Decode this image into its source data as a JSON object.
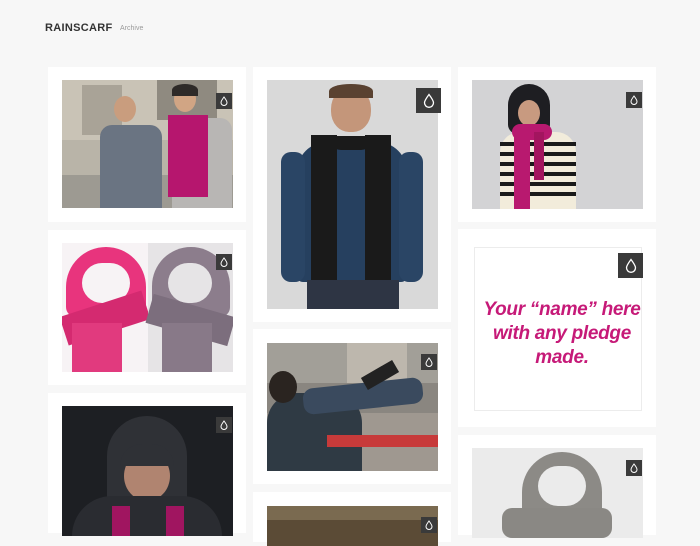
{
  "header": {
    "brand": "RAINSCARF",
    "nav_archive": "Archive"
  },
  "pledge_card": {
    "text": "Your “name” here with any pledge made."
  },
  "colors": {
    "accent_magenta": "#c61a78",
    "badge_bg": "#3a3a3a",
    "page_bg": "#f7f7f7"
  },
  "icons": {
    "badge_icon": "raindrop-icon"
  },
  "posts": [
    {
      "kind": "photo",
      "icon": "raindrop-icon"
    },
    {
      "kind": "photo",
      "icon": "raindrop-icon"
    },
    {
      "kind": "photo",
      "icon": "raindrop-icon"
    },
    {
      "kind": "photo",
      "icon": "raindrop-icon"
    },
    {
      "kind": "text",
      "icon": "raindrop-icon"
    },
    {
      "kind": "photo",
      "icon": "raindrop-icon"
    },
    {
      "kind": "photo",
      "icon": "raindrop-icon"
    },
    {
      "kind": "photo",
      "icon": "raindrop-icon"
    },
    {
      "kind": "photo",
      "icon": "raindrop-icon"
    }
  ]
}
